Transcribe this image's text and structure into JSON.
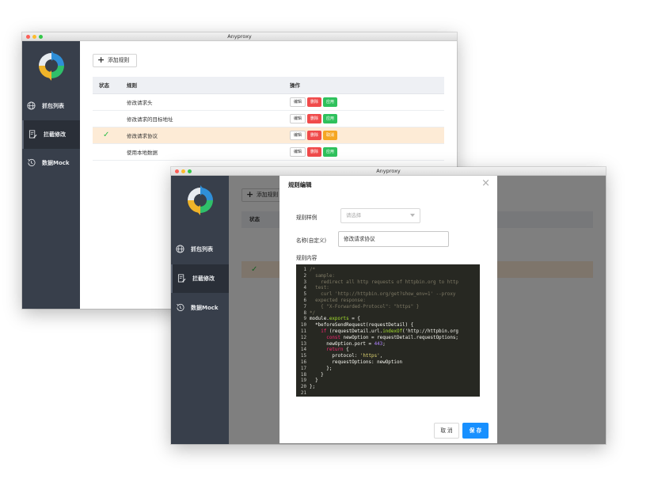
{
  "back_window": {
    "title": "Anyproxy",
    "sidebar": {
      "items": [
        {
          "label": "抓包列表",
          "icon": "globe-icon"
        },
        {
          "label": "拦截修改",
          "icon": "document-edit-icon"
        },
        {
          "label": "数据Mock",
          "icon": "history-icon"
        }
      ]
    },
    "add_button": "添加规则",
    "table": {
      "headers": [
        "状态",
        "规则",
        "操作"
      ],
      "rows": [
        {
          "status": "",
          "rule": "修改请求头",
          "ops": [
            "编辑",
            "删除",
            "应用"
          ]
        },
        {
          "status": "",
          "rule": "修改请求的目标地址",
          "ops": [
            "编辑",
            "删除",
            "应用"
          ]
        },
        {
          "status": "✓",
          "rule": "修改请求协议",
          "ops": [
            "编辑",
            "删除",
            "取消"
          ]
        },
        {
          "status": "",
          "rule": "使用本地数据",
          "ops": [
            "编辑",
            "删除",
            "应用"
          ]
        }
      ]
    }
  },
  "front_window": {
    "title": "Anyproxy",
    "sidebar": {
      "items": [
        {
          "label": "抓包列表",
          "icon": "globe-icon"
        },
        {
          "label": "拦截修改",
          "icon": "document-edit-icon"
        },
        {
          "label": "数据Mock",
          "icon": "history-icon"
        }
      ]
    },
    "add_button_partial": "添加规则",
    "table_header_partial": "状态",
    "modal": {
      "title": "规则编辑",
      "sample_label": "规则样例",
      "sample_placeholder": "请选择",
      "name_label": "名称(自定义)",
      "name_value": "修改请求协议",
      "content_label": "规则内容",
      "code_lines": [
        "/*",
        "  sample:",
        "    redirect all http requests of httpbin.org to http",
        "  test:",
        "    curl 'http://httpbin.org/get?show_env=1' --proxy",
        "  expected response:",
        "    { \"X-Forwarded-Protocol\": \"https\" }",
        "*/",
        "module.exports = {",
        "  *beforeSendRequest(requestDetail) {",
        "    if (requestDetail.url.indexOf('http://httpbin.org",
        "      const newOption = requestDetail.requestOptions;",
        "      newOption.port = 443;",
        "      return {",
        "        protocol: 'https',",
        "        requestOptions: newOption",
        "      };",
        "    }",
        "  }",
        "};",
        ""
      ],
      "cancel_button": "取 消",
      "save_button": "保 存"
    }
  },
  "colors": {
    "sidebar": "#383f4b",
    "danger": "#f04b4b",
    "success": "#2fc15c",
    "warning": "#f5a623",
    "primary": "#1890ff",
    "selected_row": "#fdebd6",
    "editor_bg": "#272822"
  }
}
